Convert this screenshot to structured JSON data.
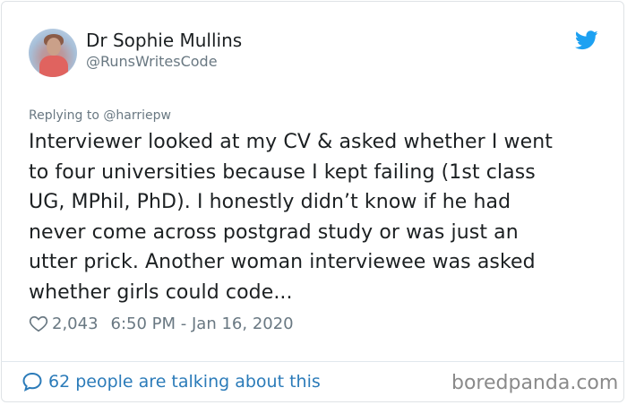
{
  "author": {
    "name": "Dr Sophie Mullins",
    "handle": "@RunsWritesCode"
  },
  "reply": {
    "label": "Replying to @harriepw"
  },
  "tweet": {
    "lines": [
      "Interviewer looked at my CV & asked whether I went",
      "to four universities because I kept failing (1st class",
      "UG, MPhil, PhD). I honestly didn’t know if he had",
      "never come across postgrad study or was just an",
      "utter prick. Another woman interviewee was asked",
      "whether girls could code..."
    ]
  },
  "meta": {
    "likes": "2,043",
    "timestamp": "6:50 PM - Jan 16, 2020"
  },
  "footer": {
    "talking": "62 people are talking about this",
    "watermark": "boredpanda.com"
  },
  "icons": {
    "bird": "twitter-bird-icon",
    "heart": "heart-icon",
    "bubble": "speech-bubble-icon"
  },
  "colors": {
    "twitter_blue": "#1da1f2",
    "link_blue": "#2b7bb9",
    "muted_gray": "#697882",
    "text": "#1c2022"
  }
}
